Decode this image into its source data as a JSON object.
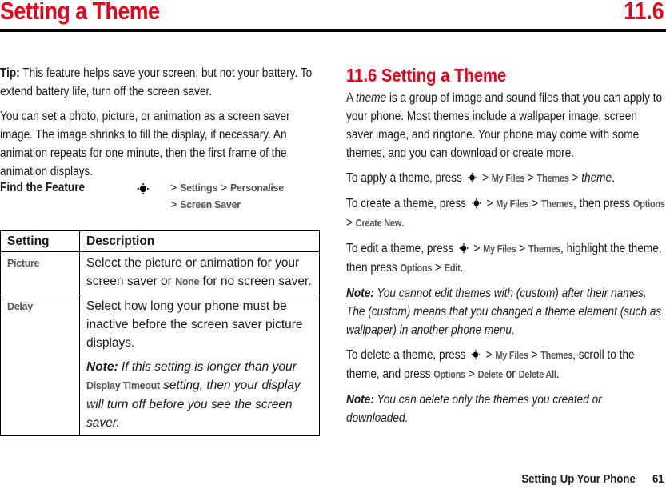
{
  "header": {
    "title": "Setting a Theme",
    "section_number": "11.6"
  },
  "left": {
    "tip_label": "Tip:",
    "tip_text": " This feature helps save your screen, but not your battery. To extend battery life, turn off the screen saver.",
    "intro": "You can set a photo, picture, or animation as a screen saver image. The image shrinks to fill the display, if necessary. An animation repeats for one minute, then the first frame of the animation displays.",
    "find_feature": {
      "label": "Find the Feature",
      "icon": "nav-key-icon",
      "sep": ">",
      "path": [
        "Settings",
        "Personalise",
        "Screen Saver"
      ]
    },
    "table": {
      "headers": [
        "Setting",
        "Description"
      ],
      "rows": [
        {
          "setting": "Picture",
          "desc_pre": "Select the picture or animation for your screen saver or ",
          "desc_menu": "None",
          "desc_post": " for no screen saver."
        },
        {
          "setting": "Delay",
          "desc": "Select how long your phone must be inactive before the screen saver picture displays.",
          "note_label": "Note:",
          "note_pre": " If this setting is longer than your ",
          "note_menu": "Display Timeout",
          "note_post": " setting, then your display will turn off before you see the screen saver."
        }
      ]
    }
  },
  "right": {
    "section_title": "11.6 Setting a Theme",
    "intro_a": "A ",
    "intro_term": "theme",
    "intro_b": " is a group of image and sound files that you can apply to your phone. Most themes include a wallpaper image, screen saver image, and ringtone. Your phone may come with some themes, and you can download or create more.",
    "apply": {
      "pre": "To apply a theme, press",
      "m1": "My Files",
      "m2": "Themes",
      "end_italic": "theme",
      "post": "."
    },
    "create": {
      "pre": "To create a theme, press",
      "m1": "My Files",
      "m2": "Themes",
      "mid": ", then press ",
      "m3": "Options",
      "m4": "Create New",
      "post": "."
    },
    "edit": {
      "pre": "To edit a theme, press",
      "m1": "My Files",
      "m2": "Themes",
      "mid": ", highlight the theme, then press ",
      "m3": "Options",
      "m4": "Edit",
      "post": "."
    },
    "note1": {
      "label": "Note:",
      "text": " You cannot edit themes with (custom) after their names. The (custom) means that you changed a theme element (such as wallpaper) in another phone menu."
    },
    "delete": {
      "pre": "To delete a theme, press",
      "m1": "My Files",
      "m2": "Themes",
      "mid": ", scroll to the theme, and press ",
      "m3": "Options",
      "m4": "Delete",
      "or": " or ",
      "m5": "Delete All",
      "post": "."
    },
    "note2": {
      "label": "Note:",
      "text": " You can delete only the themes you created or downloaded."
    },
    "gt": ">"
  },
  "footer": {
    "chapter": "Setting Up Your Phone",
    "page": "61"
  }
}
